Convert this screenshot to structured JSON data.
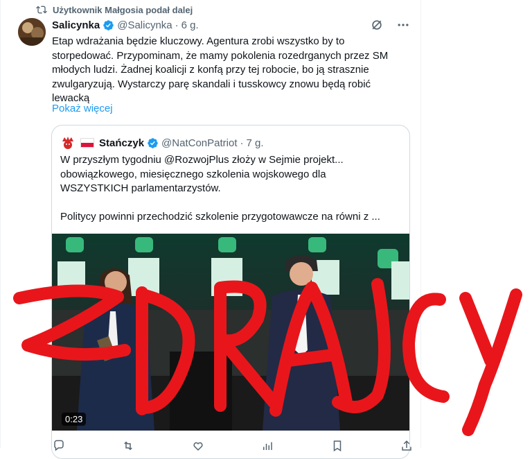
{
  "repost": {
    "text": "Użytkownik Małgosia podał dalej"
  },
  "tweet": {
    "name": "Salicynka",
    "handle": "@Salicynka",
    "separator": "·",
    "time": "6 g.",
    "text": "Etap wdrażania będzie kluczowy. Agentura zrobi wszystko by to\nstorpedować. Przypominam, że mamy pokolenia rozedrganych przez SM\nmłodych ludzi. Żadnej koalicji z konfą przy tej robocie, bo ją strasznie\nzwulgaryzują. Wystarczy parę skandali i tusskowcy znowu będą robić\nlewacką",
    "show_more": "Pokaż więcej"
  },
  "quote": {
    "name": "Stańczyk",
    "handle": "@NatConPatriot",
    "separator": "·",
    "time": "7 g.",
    "text": "W przyszłym tygodniu @RozwojPlus złoży w Sejmie projekt...\nobowiązkowego, miesięcznego szkolenia wojskowego dla\nWSZYSTKICH parlamentarzystów.\n\nPolitycy powinni przechodzić szkolenie przygotowawcze na równi z ...",
    "video_duration": "0:23"
  },
  "overlay_text": "ZDRAJCY",
  "colors": {
    "accent": "#1d9bf0",
    "overlay": "#e8161b",
    "muted": "#536471"
  }
}
